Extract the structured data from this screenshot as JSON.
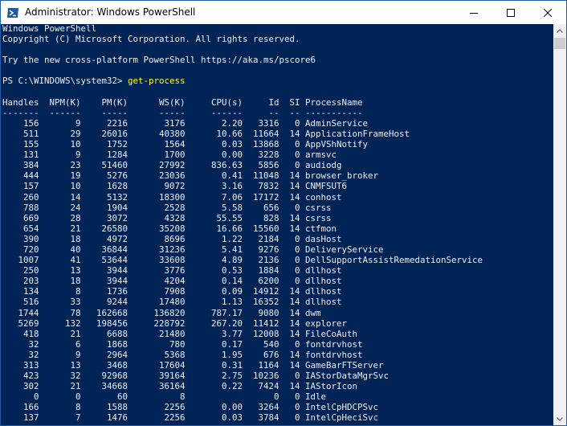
{
  "window": {
    "title": "Administrator: Windows PowerShell"
  },
  "console": {
    "banner": [
      "Windows PowerShell",
      "Copyright (C) Microsoft Corporation. All rights reserved.",
      "",
      "Try the new cross-platform PowerShell https://aka.ms/pscore6",
      ""
    ],
    "prompt": "PS C:\\WINDOWS\\system32> ",
    "command": "get-process",
    "header": "Handles  NPM(K)    PM(K)      WS(K)     CPU(s)     Id  SI ProcessName",
    "separator": "-------  ------    -----      -----     ------     --  -- -----------",
    "rows": [
      "    156       9     2216       3176       2.20   3316   0 AdminService",
      "    511      29    26016      40380      10.66  11664  14 ApplicationFrameHost",
      "    155      10     1752       1564       0.03  13868   0 AppVShNotify",
      "    131       9     1284       1700       0.00   3228   0 armsvc",
      "    384      23    51460      27992     836.63   5856   0 audiodg",
      "    444      19     5276      23036       0.41  11048  14 browser_broker",
      "    157      10     1628       9072       3.16   7832  14 CNMFSUT6",
      "    260      14     5132      18300       7.06  17172  14 conhost",
      "    788      24     1904       2528       5.58    656   0 csrss",
      "    669      28     3072       4328      55.55    828  14 csrss",
      "    654      21    26580      35208      16.66  15560  14 ctfmon",
      "    390      18     4972       8696       1.22   2184   0 dasHost",
      "    720      40    36844      31236       5.41   9276   0 DeliveryService",
      "   1007      41    53644      33608       4.89   2136   0 DellSupportAssistRemedationService",
      "    250      13     3944       3776       0.53   1884   0 dllhost",
      "    203      18     3944       4204       0.14   6200   0 dllhost",
      "    134       8     1736       7908       0.09  14912  14 dllhost",
      "    516      33     9244      17480       1.13  16352  14 dllhost",
      "   1744      78   162668     136820     787.17   9080  14 dwm",
      "   5269     132   198456     228792     267.20  11412  14 explorer",
      "    418      21     6688      21480       3.77  12008  14 FileCoAuth",
      "     32       6     1868        780       0.17    540   0 fontdrvhost",
      "     32       9     2964       5368       1.95    676  14 fontdrvhost",
      "    313      13     3468      17604       0.31   1164  14 GameBarFTServer",
      "    423      32    92968      39164       2.75  10236   0 IAStorDataMgrSvc",
      "    302      21    34668      36164       0.22   7424  14 IAStorIcon",
      "      0       0       60          8                 0   0 Idle",
      "    166       8     1588       2256       0.00   3264   0 IntelCpHDCPSvc",
      "    137       7     1476       2256       0.03   3784   0 IntelCpHeciSvc"
    ]
  }
}
